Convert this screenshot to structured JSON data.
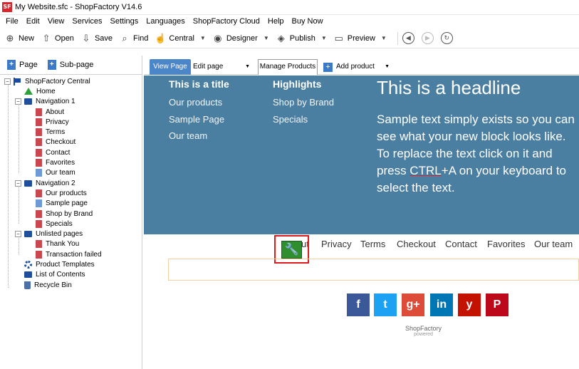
{
  "window": {
    "app_logo": "SF",
    "title": "My Website.sfc - ShopFactory V14.6"
  },
  "menu": [
    "File",
    "Edit",
    "View",
    "Services",
    "Settings",
    "Languages",
    "ShopFactory Cloud",
    "Help",
    "Buy Now"
  ],
  "toolbar": {
    "new": "New",
    "open": "Open",
    "save": "Save",
    "find": "Find",
    "central": "Central",
    "designer": "Designer",
    "publish": "Publish",
    "preview": "Preview"
  },
  "page_tools": {
    "page": "Page",
    "subpage": "Sub-page"
  },
  "tree": [
    {
      "label": "ShopFactory Central",
      "icon": "flag-icon",
      "level": 0
    },
    {
      "label": "Home",
      "icon": "home-icon",
      "level": 1
    },
    {
      "label": "Navigation 1",
      "icon": "folder-icon",
      "level": 1
    },
    {
      "label": "About",
      "icon": "page-icon",
      "level": 2
    },
    {
      "label": "Privacy",
      "icon": "page-icon",
      "level": 2
    },
    {
      "label": "Terms",
      "icon": "page-icon",
      "level": 2
    },
    {
      "label": "Checkout",
      "icon": "page-icon",
      "level": 2
    },
    {
      "label": "Contact",
      "icon": "page-icon",
      "level": 2
    },
    {
      "label": "Favorites",
      "icon": "page-icon",
      "level": 2
    },
    {
      "label": "Our team",
      "icon": "page-icon",
      "level": 2
    },
    {
      "label": "Navigation 2",
      "icon": "folder-icon",
      "level": 1
    },
    {
      "label": "Our products",
      "icon": "page-icon",
      "level": 2
    },
    {
      "label": "Sample page",
      "icon": "page-icon",
      "level": 2
    },
    {
      "label": "Shop by Brand",
      "icon": "page-icon",
      "level": 2
    },
    {
      "label": "Specials",
      "icon": "page-icon",
      "level": 2
    },
    {
      "label": "Unlisted pages",
      "icon": "folder-icon",
      "level": 1
    },
    {
      "label": "Thank You",
      "icon": "page-icon",
      "level": 2
    },
    {
      "label": "Transaction failed",
      "icon": "page-icon",
      "level": 2
    },
    {
      "label": "Product Templates",
      "icon": "gear-icon",
      "level": 1
    },
    {
      "label": "List of Contents",
      "icon": "folder-icon",
      "level": 1
    },
    {
      "label": "Recycle Bin",
      "icon": "bin-icon",
      "level": 1
    }
  ],
  "tabs": {
    "view": "View Page",
    "edit": "Edit page",
    "manage": "Manage Products",
    "add": "Add product"
  },
  "content": {
    "col1_title": "This is a title",
    "col1_links": [
      "Our products",
      "Sample Page",
      "Our team"
    ],
    "col2_title": "Highlights",
    "col2_links": [
      "Shop by Brand",
      "Specials"
    ],
    "headline": "This is a headline",
    "body_pre": "Sample text simply exists so you can see what your new block looks like. To replace the text click on it and press ",
    "body_ctrl": "CTRL",
    "body_post": "+A on your keyboard to select the text.",
    "nav_partial": "ut",
    "nav": [
      "Privacy",
      "Terms",
      "Checkout",
      "Contact",
      "Favorites",
      "Our team"
    ],
    "social": [
      {
        "name": "facebook",
        "glyph": "f",
        "color": "#3b5998"
      },
      {
        "name": "twitter",
        "glyph": "t",
        "color": "#1da1f2"
      },
      {
        "name": "google-plus",
        "glyph": "g+",
        "color": "#dd4b39"
      },
      {
        "name": "linkedin",
        "glyph": "in",
        "color": "#0077b5"
      },
      {
        "name": "yelp",
        "glyph": "y",
        "color": "#c41200"
      },
      {
        "name": "pinterest",
        "glyph": "P",
        "color": "#bd081c"
      }
    ],
    "brand": "ShopFactory",
    "brand_sub": "powered"
  }
}
